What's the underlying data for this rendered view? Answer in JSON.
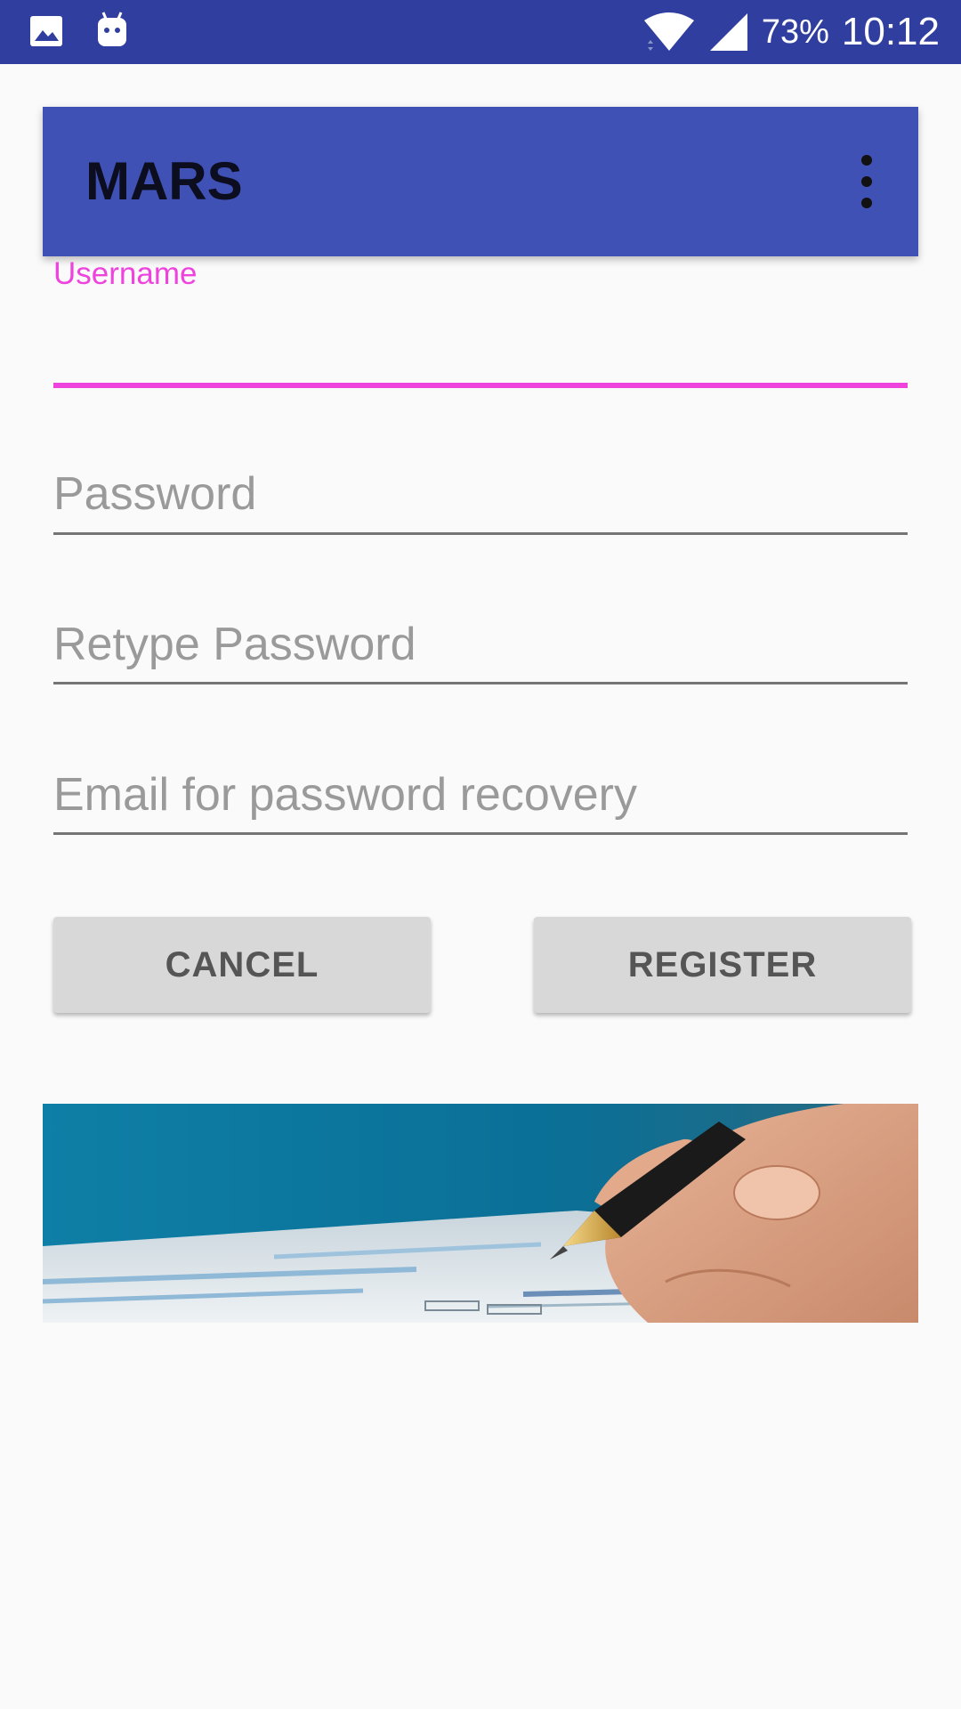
{
  "status_bar": {
    "battery": "73%",
    "time": "10:12",
    "icons": [
      "image-icon",
      "android-icon",
      "wifi-icon",
      "signal-icon"
    ]
  },
  "app_bar": {
    "title": "MARS",
    "overflow_icon": "more-vert-icon"
  },
  "form": {
    "username": {
      "label": "Username",
      "value": ""
    },
    "password": {
      "placeholder": "Password",
      "value": ""
    },
    "retype_password": {
      "placeholder": "Retype Password",
      "value": ""
    },
    "email": {
      "placeholder": "Email for password recovery",
      "value": ""
    }
  },
  "buttons": {
    "cancel": "CANCEL",
    "register": "REGISTER"
  },
  "colors": {
    "status_bar": "#303f9f",
    "app_bar": "#3f51b5",
    "accent": "#ee44dd",
    "button_bg": "#d8d8d8"
  }
}
